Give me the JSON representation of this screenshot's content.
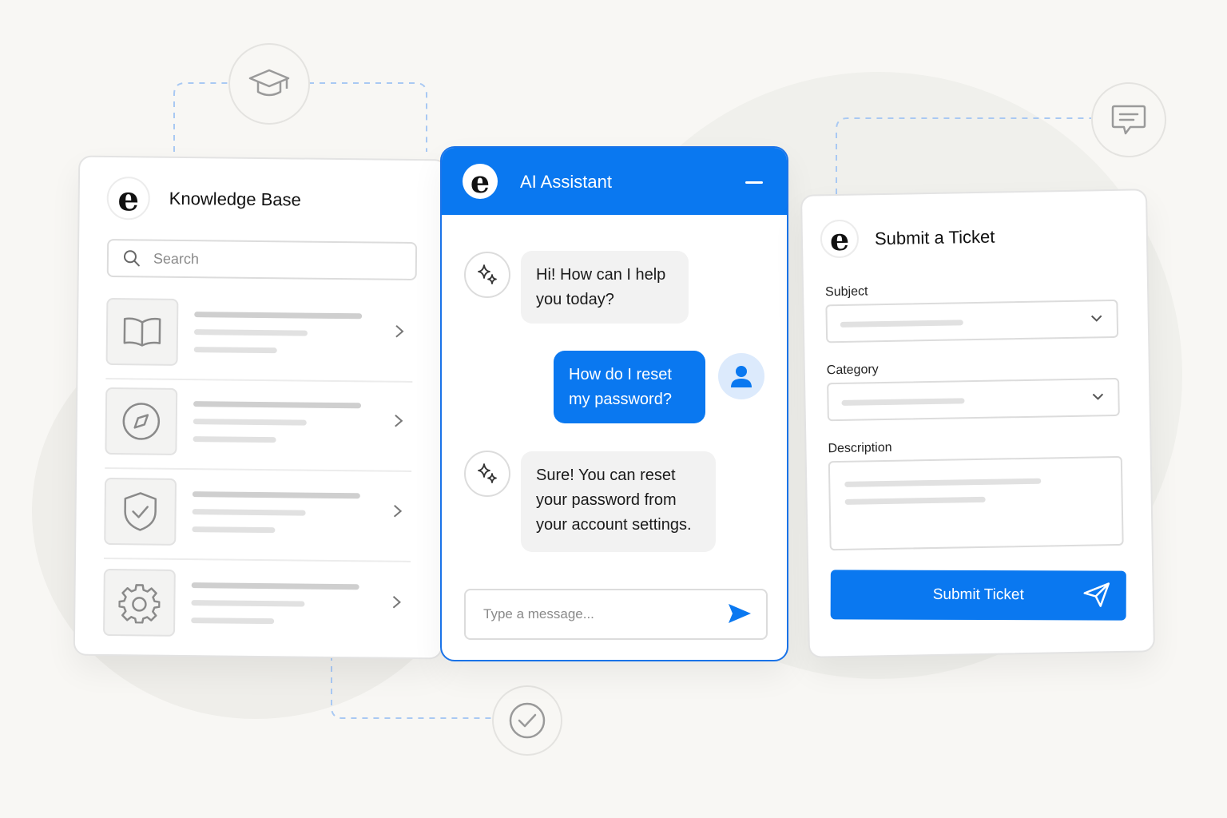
{
  "colors": {
    "accent": "#0a78f0",
    "background": "#f8f7f4"
  },
  "decor_icons": [
    "graduation-cap-icon",
    "chat-icon",
    "check-circle-icon"
  ],
  "knowledge_base": {
    "logo": "e",
    "title": "Knowledge Base",
    "search_placeholder": "Search",
    "items": [
      {
        "icon": "book-icon"
      },
      {
        "icon": "compass-icon"
      },
      {
        "icon": "shield-check-icon"
      },
      {
        "icon": "gear-icon"
      }
    ]
  },
  "chat": {
    "logo": "e",
    "title": "AI Assistant",
    "messages": [
      {
        "from": "bot",
        "text": "Hi! How can I help you today?"
      },
      {
        "from": "user",
        "text": "How do I reset my password?"
      },
      {
        "from": "bot",
        "text": "Sure! You can reset your password from your account settings."
      }
    ],
    "input_placeholder": "Type a message..."
  },
  "ticket": {
    "logo": "e",
    "title": "Submit a Ticket",
    "subject_label": "Subject",
    "category_label": "Category",
    "description_label": "Description",
    "submit_label": "Submit Ticket"
  }
}
